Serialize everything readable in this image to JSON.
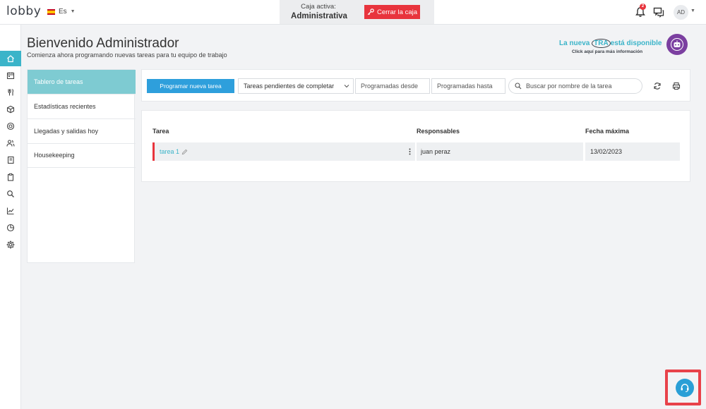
{
  "header": {
    "logo": "lobby",
    "language": "Es",
    "caja_label": "Caja activa:",
    "caja_name": "Administrativa",
    "close_cash_label": "Cerrar la caja",
    "notification_count": "2",
    "user_initials": "AD"
  },
  "sidebar": {
    "items": [
      {
        "icon": "home-icon",
        "active": true
      },
      {
        "icon": "calendar-icon"
      },
      {
        "icon": "restaurant-icon"
      },
      {
        "icon": "box-icon"
      },
      {
        "icon": "money-icon"
      },
      {
        "icon": "users-icon"
      },
      {
        "icon": "book-icon"
      },
      {
        "icon": "clipboard-icon"
      },
      {
        "icon": "search-icon"
      },
      {
        "icon": "chart-line-icon"
      },
      {
        "icon": "pie-chart-icon"
      },
      {
        "icon": "settings-icon"
      }
    ]
  },
  "welcome": {
    "title": "Bienvenido Administrador",
    "subtitle": "Comienza ahora programando nuevas tareas para tu equipo de trabajo"
  },
  "promo": {
    "line_before": "La nueva",
    "highlight": "TRA",
    "line_after": "está disponible",
    "sub": "Click aquí para más información"
  },
  "left_menu": {
    "items": [
      {
        "label": "Tablero de tareas",
        "active": true
      },
      {
        "label": "Estadísticas recientes"
      },
      {
        "label": "Llegadas y salidas hoy"
      },
      {
        "label": "Housekeeping"
      }
    ]
  },
  "toolbar": {
    "new_task_label": "Programar nueva tarea",
    "filter_selected": "Tareas pendientes de completar",
    "date_from_placeholder": "Programadas desde",
    "date_to_placeholder": "Programadas hasta",
    "search_placeholder": "Buscar por nombre de la tarea"
  },
  "tasks": {
    "columns": [
      "Tarea",
      "Responsables",
      "Fecha máxima"
    ],
    "rows": [
      {
        "name": "tarea 1",
        "responsable": "juan peraz",
        "fecha": "13/02/2023"
      }
    ]
  },
  "colors": {
    "accent": "#3bb4c9",
    "primary_button": "#2e9fdc",
    "danger": "#e8343d",
    "promo_purple": "#7b3fa0"
  }
}
